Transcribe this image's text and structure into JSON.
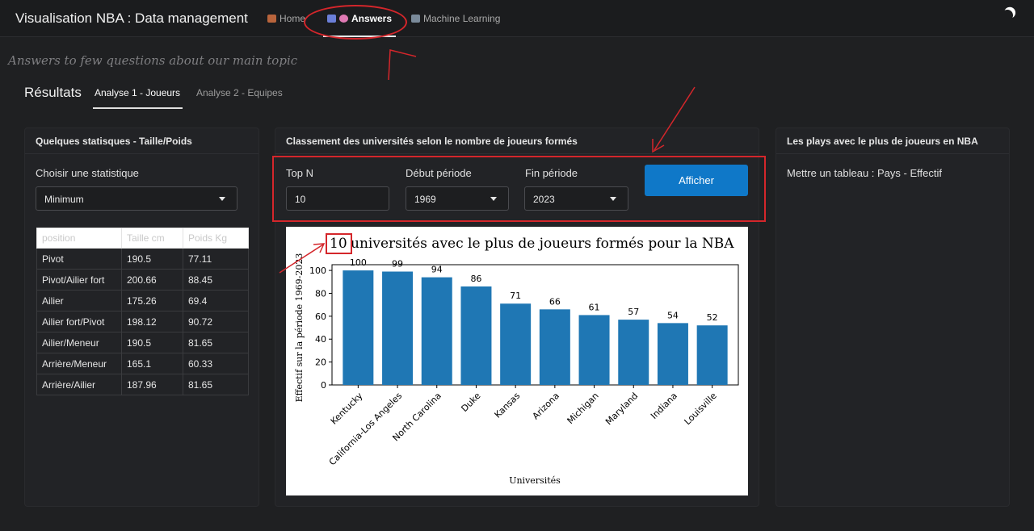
{
  "navbar": {
    "brand": "Visualisation NBA : Data management",
    "links": [
      {
        "label": "Home",
        "icon": "house-icon"
      },
      {
        "label": "Answers",
        "icon": "chart-icon"
      },
      {
        "label": "Machine Learning",
        "icon": "chart-icon"
      }
    ],
    "theme_icon": "moon-icon"
  },
  "subtitle": "Answers to few questions about our main topic",
  "results": {
    "title": "Résultats",
    "tabs": [
      "Analyse 1 - Joueurs",
      "Analyse 2 - Equipes"
    ]
  },
  "left_card": {
    "title": "Quelques statisques - Taille/Poids",
    "choose_label": "Choisir une statistique",
    "selected": "Minimum",
    "table": {
      "headers": [
        "position",
        "Taille cm",
        "Poids Kg"
      ],
      "rows": [
        [
          "Pivot",
          "190.5",
          "77.11"
        ],
        [
          "Pivot/Ailier fort",
          "200.66",
          "88.45"
        ],
        [
          "Ailier",
          "175.26",
          "69.4"
        ],
        [
          "Ailier fort/Pivot",
          "198.12",
          "90.72"
        ],
        [
          "Ailier/Meneur",
          "190.5",
          "81.65"
        ],
        [
          "Arrière/Meneur",
          "165.1",
          "60.33"
        ],
        [
          "Arrière/Ailier",
          "187.96",
          "81.65"
        ]
      ]
    }
  },
  "middle_card": {
    "title": "Classement des universités selon le nombre de joueurs formés",
    "topn_label": "Top N",
    "topn_value": "10",
    "start_label": "Début période",
    "start_value": "1969",
    "end_label": "Fin période",
    "end_value": "2023",
    "button": "Afficher"
  },
  "right_card": {
    "title": "Les plays avec le plus de joueurs en NBA",
    "text": "Mettre un tableau : Pays - Effectif"
  },
  "colors": {
    "accent": "#0f78c8",
    "bar": "#1f77b4",
    "annotation": "#d4262b"
  },
  "chart_data": {
    "type": "bar",
    "title_number": "10",
    "title": "universités avec le plus de joueurs formés pour la NBA",
    "xlabel": "Universités",
    "ylabel": "Effectif sur la période 1969-2023",
    "categories": [
      "Kentucky",
      "California-Los Angeles",
      "North Carolina",
      "Duke",
      "Kansas",
      "Arizona",
      "Michigan",
      "Maryland",
      "Indiana",
      "Louisville"
    ],
    "values": [
      100,
      99,
      94,
      86,
      71,
      66,
      61,
      57,
      54,
      52
    ],
    "yticks": [
      "0",
      "20",
      "40",
      "60",
      "80",
      "100"
    ],
    "ylim": [
      0,
      105
    ]
  }
}
